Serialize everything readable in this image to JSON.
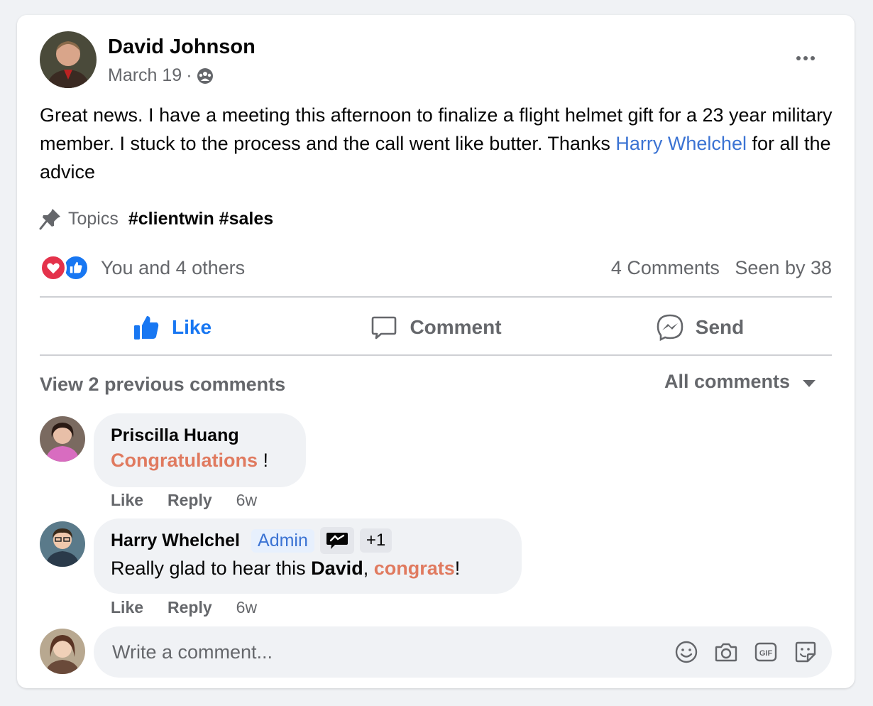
{
  "post": {
    "author": "David Johnson",
    "date": "March 19",
    "separator": "·",
    "audience_icon": "group-icon",
    "text": "Great news. I have a meeting this afternoon to finalize a flight helmet gift for a 23 year military member. I stuck to the process and the call went like butter. Thanks ",
    "mention": "Harry Whelchel",
    "text_end": " for all the advice",
    "topics_label": "Topics",
    "topics_tags": "#clientwin #sales"
  },
  "stats": {
    "reacted_by": "You and 4 others",
    "comments": "4 Comments",
    "seen": "Seen by 38"
  },
  "actions": {
    "like": "Like",
    "comment": "Comment",
    "send": "Send"
  },
  "comments_section": {
    "view_previous": "View 2 previous comments",
    "filter": "All comments"
  },
  "comments": [
    {
      "author": "Priscilla Huang",
      "highlight": "Congratulations",
      "suffix": " !",
      "like": "Like",
      "reply": "Reply",
      "time": "6w"
    },
    {
      "author": "Harry Whelchel",
      "badge": "Admin",
      "badge_extra": "+1",
      "text_prefix": "Really glad to hear this ",
      "text_bold": "David",
      "text_mid": ", ",
      "highlight": "congrats",
      "suffix": "!",
      "like": "Like",
      "reply": "Reply",
      "time": "6w"
    }
  ],
  "composer": {
    "placeholder": "Write a comment..."
  },
  "colors": {
    "accent": "#1877f2",
    "mention": "#3b73d3",
    "highlight": "#e07a5f",
    "love": "#e4324b"
  }
}
